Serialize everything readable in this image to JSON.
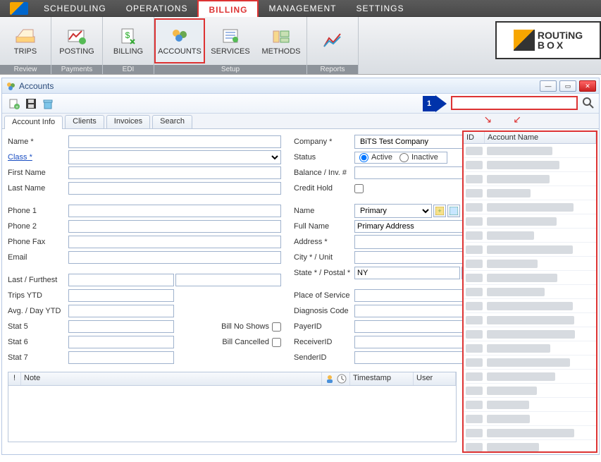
{
  "menu": {
    "items": [
      "SCHEDULING",
      "OPERATIONS",
      "BILLING",
      "MANAGEMENT",
      "SETTINGS"
    ],
    "active_index": 2
  },
  "ribbon": {
    "groups": [
      {
        "label": "Review",
        "buttons": [
          {
            "name": "trips",
            "label": "TRIPS"
          }
        ]
      },
      {
        "label": "Payments",
        "buttons": [
          {
            "name": "posting",
            "label": "POSTING"
          }
        ]
      },
      {
        "label": "EDI",
        "buttons": [
          {
            "name": "billing",
            "label": "BILLING"
          }
        ]
      },
      {
        "label": "Setup",
        "buttons": [
          {
            "name": "accounts",
            "label": "ACCOUNTS",
            "selected": true
          },
          {
            "name": "services",
            "label": "SERVICES"
          },
          {
            "name": "methods",
            "label": "METHODS"
          }
        ]
      },
      {
        "label": "Reports",
        "buttons": [
          {
            "name": "reports",
            "label": ""
          }
        ]
      }
    ]
  },
  "brand": {
    "line1": "ROUTiNG",
    "line2": "BOX"
  },
  "window": {
    "title": "Accounts"
  },
  "step_marker": "1",
  "search": {
    "placeholder": "",
    "value": ""
  },
  "tabs": [
    "Account Info",
    "Clients",
    "Invoices",
    "Search"
  ],
  "active_tab_index": 0,
  "form": {
    "left": {
      "name_label": "Name",
      "class_label": "Class",
      "first_name_label": "First Name",
      "last_name_label": "Last Name",
      "phone1_label": "Phone 1",
      "phone2_label": "Phone 2",
      "phonefax_label": "Phone Fax",
      "email_label": "Email",
      "last_furthest_label": "Last / Furthest",
      "trips_ytd_label": "Trips YTD",
      "avg_day_ytd_label": "Avg. / Day YTD",
      "stat5_label": "Stat 5",
      "stat6_label": "Stat 6",
      "stat7_label": "Stat 7",
      "bill_no_shows_label": "Bill No Shows",
      "bill_cancelled_label": "Bill Cancelled",
      "values": {
        "name": "",
        "class": "",
        "first_name": "",
        "last_name": "",
        "phone1": "",
        "phone2": "",
        "phonefax": "",
        "email": "",
        "last_furthest": "",
        "trips_ytd": "",
        "avg_day_ytd": "",
        "stat5": "",
        "stat6": "",
        "stat7": "",
        "bill_no_shows": false,
        "bill_cancelled": false
      }
    },
    "right": {
      "company_label": "Company",
      "company_value": "BiTS Test Company",
      "status_label": "Status",
      "status_active_label": "Active",
      "status_inactive_label": "Inactive",
      "status_value": "Active",
      "balance_label": "Balance / Inv. #",
      "credit_hold_label": "Credit Hold",
      "credit_hold_value": false,
      "addr_name_label": "Name",
      "addr_name_value": "Primary",
      "full_name_label": "Full Name",
      "full_name_value": "Primary Address",
      "address_label": "Address",
      "city_unit_label": "City * / Unit",
      "state_postal_label": "State * / Postal *",
      "state_value": "NY",
      "pos_label": "Place of Service",
      "diag_label": "Diagnosis Code",
      "payerid_label": "PayerID",
      "receiverid_label": "ReceiverID",
      "senderid_label": "SenderID",
      "values": {
        "balance": "",
        "address": "",
        "city": "",
        "unit": "",
        "postal": "",
        "pos": "",
        "diag": "",
        "payerid": "",
        "receiverid": "",
        "senderid": ""
      }
    }
  },
  "notes": {
    "col_excl": "!",
    "col_note": "Note",
    "col_timestamp": "Timestamp",
    "col_user": "User"
  },
  "sidelist": {
    "col_id": "ID",
    "col_name": "Account Name",
    "row_count": 22
  }
}
